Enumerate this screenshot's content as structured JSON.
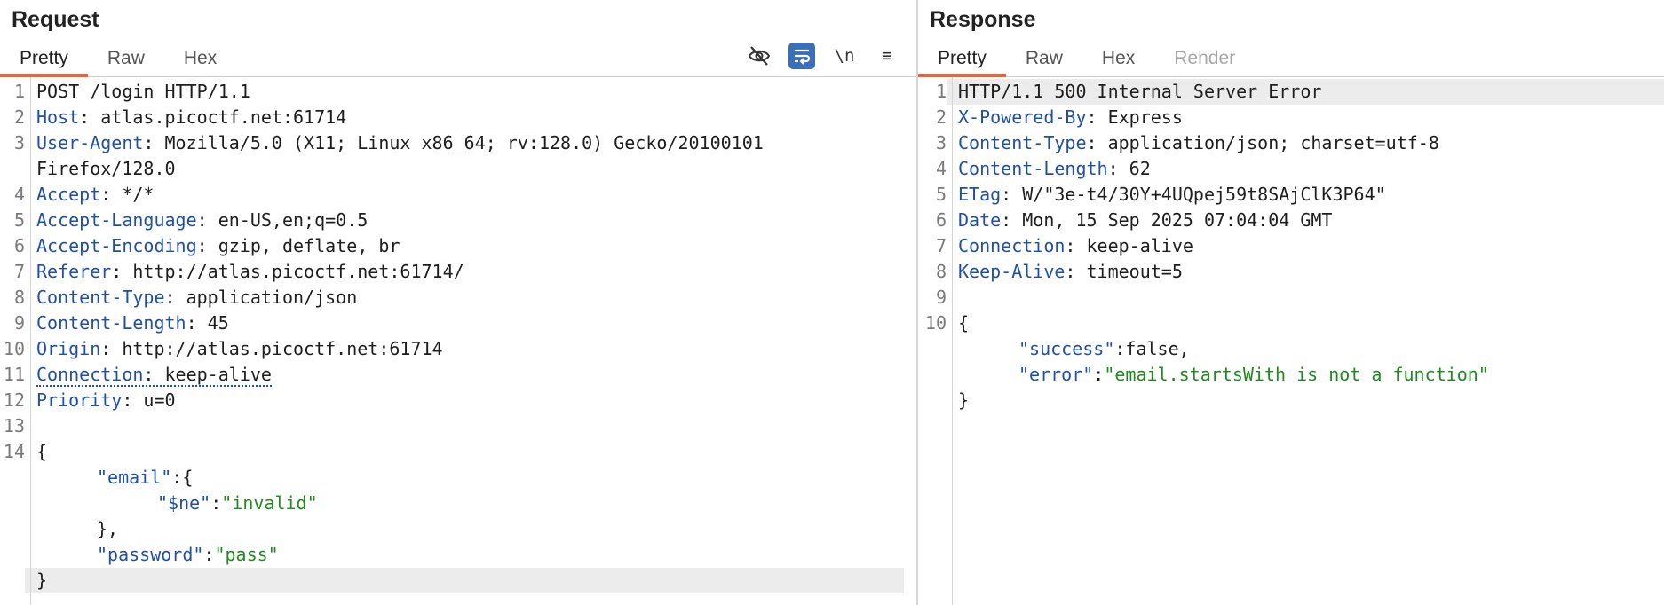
{
  "request": {
    "title": "Request",
    "tabs": [
      "Pretty",
      "Raw",
      "Hex"
    ],
    "active_tab": "Pretty",
    "tools": [
      {
        "name": "hide-nonprintable-icon",
        "label": ""
      },
      {
        "name": "wrap-lines-icon",
        "label": ""
      },
      {
        "name": "newline-toggle",
        "label": "\\n"
      },
      {
        "name": "menu-icon",
        "label": "≡"
      }
    ],
    "lines": {
      "l1": "POST /login HTTP/1.1",
      "l2k": "Host",
      "l2v": ": atlas.picoctf.net:61714",
      "l3k": "User-Agent",
      "l3v": ": Mozilla/5.0 (X11; Linux x86_64; rv:128.0) Gecko/20100101",
      "l3c": "Firefox/128.0",
      "l4k": "Accept",
      "l4v": ": */*",
      "l5k": "Accept-Language",
      "l5v": ": en-US,en;q=0.5",
      "l6k": "Accept-Encoding",
      "l6v": ": gzip, deflate, br",
      "l7k": "Referer",
      "l7v": ": http://atlas.picoctf.net:61714/",
      "l8k": "Content-Type",
      "l8v": ": application/json",
      "l9k": "Content-Length",
      "l9v": ": 45",
      "l10k": "Origin",
      "l10v": ": http://atlas.picoctf.net:61714",
      "l11k": "Connection",
      "l11v": ": keep-alive",
      "l12k": "Priority",
      "l12v": ": u=0",
      "l14": "{",
      "b1k": "\"email\"",
      "b1v": ":{",
      "b2k": "\"$ne\"",
      "b2c": ":",
      "b2v": "\"invalid\"",
      "b3": "},",
      "b4k": "\"password\"",
      "b4c": ":",
      "b4v": "\"pass\"",
      "b5": "}"
    },
    "line_numbers": [
      "1",
      "2",
      "3",
      "4",
      "5",
      "6",
      "7",
      "8",
      "9",
      "10",
      "11",
      "12",
      "13",
      "14"
    ]
  },
  "response": {
    "title": "Response",
    "tabs": [
      "Pretty",
      "Raw",
      "Hex",
      "Render"
    ],
    "active_tab": "Pretty",
    "lines": {
      "l1": "HTTP/1.1 500 Internal Server Error",
      "l2k": "X-Powered-By",
      "l2v": ": Express",
      "l3k": "Content-Type",
      "l3v": ": application/json; charset=utf-8",
      "l4k": "Content-Length",
      "l4v": ": 62",
      "l5k": "ETag",
      "l5v": ": W/\"3e-t4/30Y+4UQpej59t8SAjClK3P64\"",
      "l6k": "Date",
      "l6v": ": Mon, 15 Sep 2025 07:04:04 GMT",
      "l7k": "Connection",
      "l7v": ": keep-alive",
      "l8k": "Keep-Alive",
      "l8v": ": timeout=5",
      "l10": "{",
      "b1k": "\"success\"",
      "b1v": ":false,",
      "b2k": "\"error\"",
      "b2c": ":",
      "b2v": "\"email.startsWith is not a function\"",
      "b3": "}"
    },
    "line_numbers": [
      "1",
      "2",
      "3",
      "4",
      "5",
      "6",
      "7",
      "8",
      "9",
      "10"
    ]
  },
  "colors": {
    "accent": "#e8643c",
    "header_name": "#1f4fa6",
    "json_string": "#1f8a1f",
    "toggle_on": "#3a6fb7"
  }
}
